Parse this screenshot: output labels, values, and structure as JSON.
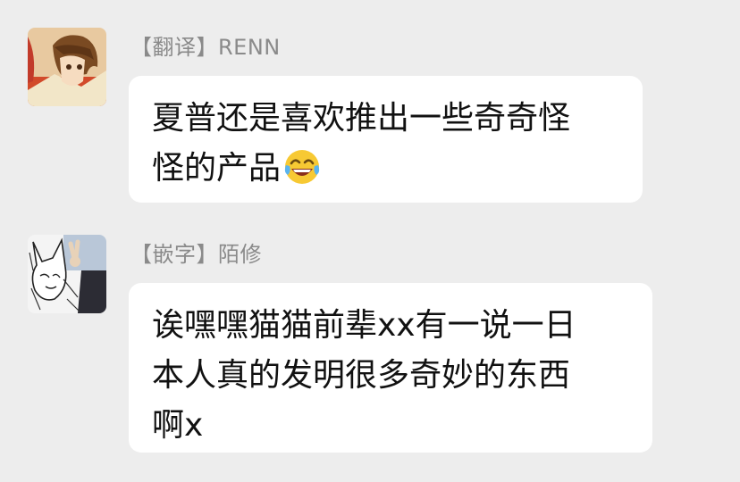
{
  "messages": [
    {
      "sender": "【翻译】RENN",
      "avatar_icon": "anime-boy-avatar",
      "lines": [
        "夏普还是喜欢推出一些奇奇怪",
        "怪的产品"
      ],
      "emoji": "laughing-crying-emoji"
    },
    {
      "sender": "【嵌字】陌修",
      "avatar_icon": "sketch-cat-avatar",
      "lines": [
        "诶嘿嘿猫猫前辈xx有一说一日",
        "本人真的发明很多奇妙的东西",
        "啊x"
      ]
    }
  ],
  "colors": {
    "background": "#ededed",
    "bubble": "#ffffff",
    "sender_text": "#8a8a8a",
    "message_text": "#111111"
  }
}
